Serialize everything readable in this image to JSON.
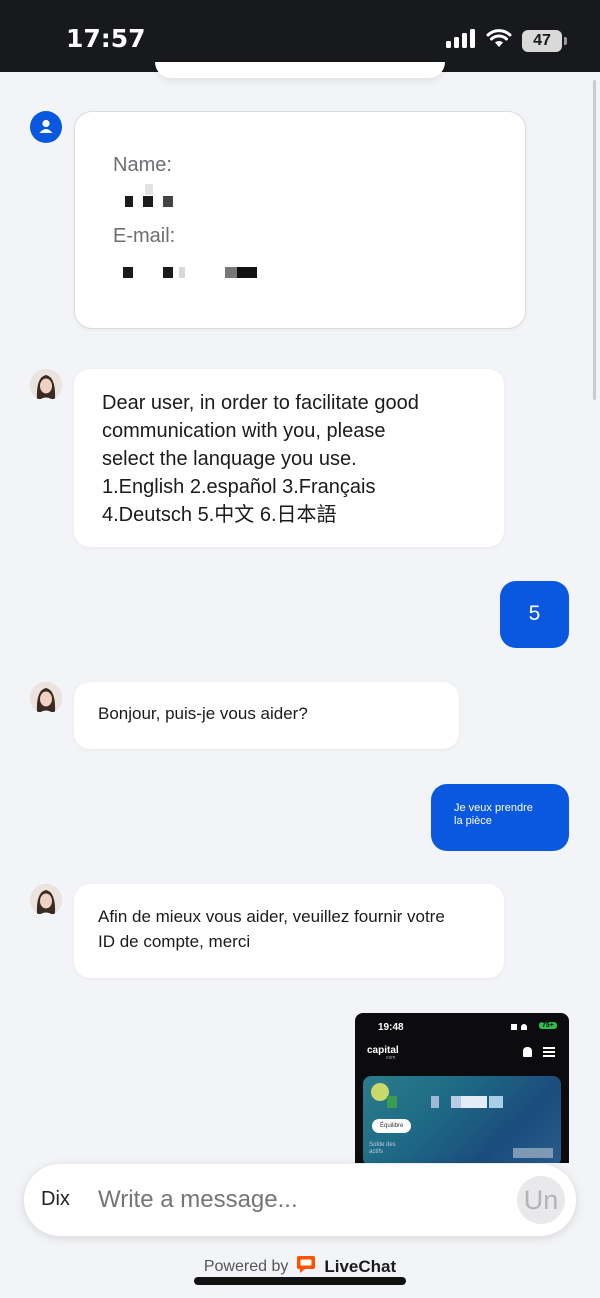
{
  "status_bar": {
    "time": "17:57",
    "battery": "47"
  },
  "form_card": {
    "name_label": "Name:",
    "email_label": "E-mail:"
  },
  "messages": {
    "agent_1": {
      "lines": [
        "Dear user, in order to facilitate good",
        "communication with you, please",
        "select the lanquage you use.",
        "1.English 2.español 3.Français",
        "4.Deutsch 5.中文 6.日本語"
      ]
    },
    "user_1": "5",
    "agent_2": "Bonjour, puis-je vous aider?",
    "user_2": {
      "lines": [
        "Je veux prendre",
        "la pièce"
      ]
    },
    "agent_3": {
      "lines": [
        "Afin de mieux vous aider, veuillez fournir votre",
        "ID de compte, merci"
      ]
    }
  },
  "attachment": {
    "time": "19:48",
    "battery": "75+",
    "brand": "capital",
    "brand_sub": "com",
    "button": "Équilibre",
    "caption_line1": "Solde des",
    "caption_line2": "actifs"
  },
  "composer": {
    "left_label": "Dix",
    "placeholder": "Write a message...",
    "send_label": "Un"
  },
  "footer": {
    "powered_by": "Powered by",
    "brand": "LiveChat"
  },
  "colors": {
    "accent": "#0a58e0",
    "livechat_orange": "#ff5100",
    "background": "#f3f4f7"
  }
}
